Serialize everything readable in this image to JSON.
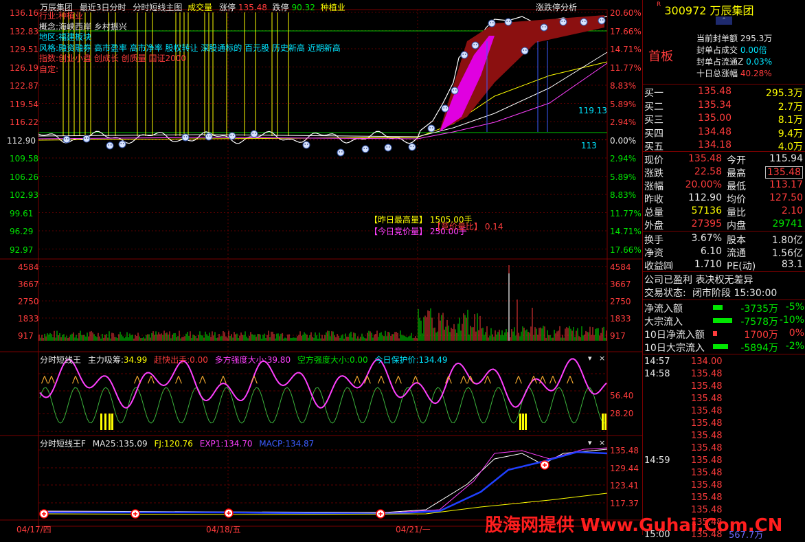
{
  "header": {
    "stock_name": "万辰集团",
    "period": "最近3日分时",
    "indicator": "分时短线主图",
    "volume_label": "成交量",
    "limit_up_label": "涨停",
    "limit_up_value": "135.48",
    "limit_down_label": "跌停",
    "limit_down_value": "90.32",
    "sector": "种植业",
    "analysis_link": "涨跌停分析"
  },
  "info_lines": {
    "industry": "行业:种植业",
    "concept": "概念:海峡西岸 乡村振兴",
    "region": "地区:福建板块",
    "style": "风格:融资融券 高市盈率 高市净率 股权转让 深股通标的 百元股 历史新高 近期新高",
    "index": "指数:创业小盘 创成长 创质量 国证2000",
    "custom": "自定:"
  },
  "price_axis": {
    "left": [
      "136.16",
      "132.83",
      "129.51",
      "126.19",
      "122.87",
      "119.54",
      "116.22",
      "112.90",
      "109.58",
      "106.26",
      "102.93",
      "99.61",
      "96.29",
      "92.97"
    ],
    "right": [
      "20.60%",
      "17.66%",
      "14.71%",
      "11.77%",
      "8.83%",
      "5.89%",
      "2.94%",
      "0.00%",
      "2.94%",
      "5.89%",
      "8.83%",
      "11.77%",
      "14.71%",
      "17.66%"
    ]
  },
  "volume_axis": [
    "4584",
    "3667",
    "2750",
    "1833",
    "917"
  ],
  "price_annotations": {
    "level_1": "113",
    "level_2": "119.13"
  },
  "volume_info": {
    "prev_high_label": "【昨日最高量】",
    "prev_high_value": "1505.00手",
    "today_auction_label": "【今日竞价量】",
    "today_auction_value": "250.00手",
    "auction_ratio_label": "【竞价量比】",
    "auction_ratio_value": "0.14"
  },
  "panel1": {
    "title": "分时短线王",
    "main_label": "主力吸筹:",
    "main_value": "34.99",
    "exit_label": "赶快出手:",
    "exit_value": "0.00",
    "bull_label": "多方强度大小:",
    "bull_value": "39.80",
    "bear_label": "空方强度大小:",
    "bear_value": "0.00",
    "protect_label": "今日保护价:",
    "protect_value": "134.49",
    "axis": [
      "56.40",
      "28.20"
    ]
  },
  "panel2": {
    "title": "分时短线王F",
    "ma25_label": "MA25:",
    "ma25_value": "135.09",
    "fj_label": "FJ:",
    "fj_value": "120.76",
    "exp1_label": "EXP1:",
    "exp1_value": "134.70",
    "macp_label": "MACP:",
    "macp_value": "134.87",
    "axis": [
      "135.48",
      "129.44",
      "123.41",
      "117.37"
    ]
  },
  "date_axis": [
    "04/17/四",
    "04/18/五",
    "04/21/一"
  ],
  "right_panel": {
    "code": "300972",
    "name": "万辰集团",
    "board": "首板",
    "seal_amount_label": "当前封单额",
    "seal_amount": "295.3万",
    "seal_ratio_label": "封单占成交",
    "seal_ratio": "0.00倍",
    "seal_float_label": "封单占流通Z",
    "seal_float": "0.03%",
    "ten_day_label": "十日总涨幅",
    "ten_day": "40.28%",
    "bids": [
      {
        "label": "买一",
        "price": "135.48",
        "vol": "295.3万"
      },
      {
        "label": "买二",
        "price": "135.34",
        "vol": "2.7万"
      },
      {
        "label": "买三",
        "price": "135.00",
        "vol": "8.1万"
      },
      {
        "label": "买四",
        "price": "134.48",
        "vol": "9.4万"
      },
      {
        "label": "买五",
        "price": "134.18",
        "vol": "4.0万"
      }
    ],
    "quote": [
      {
        "l1": "现价",
        "v1": "135.48",
        "l2": "今开",
        "v2": "115.94"
      },
      {
        "l1": "涨跌",
        "v1": "22.58",
        "l2": "最高",
        "v2": "135.48"
      },
      {
        "l1": "涨幅",
        "v1": "20.00%",
        "l2": "最低",
        "v2": "113.17"
      },
      {
        "l1": "昨收",
        "v1": "112.90",
        "l2": "均价",
        "v2": "127.50"
      },
      {
        "l1": "总量",
        "v1": "57136",
        "l2": "量比",
        "v2": "2.10"
      },
      {
        "l1": "外盘",
        "v1": "27395",
        "l2": "内盘",
        "v2": "29741"
      }
    ],
    "fundamentals": [
      {
        "l1": "换手",
        "v1": "3.67%",
        "l2": "股本",
        "v2": "1.80亿"
      },
      {
        "l1": "净资",
        "v1": "6.10",
        "l2": "流通",
        "v2": "1.56亿"
      },
      {
        "l1": "收益㈣",
        "v1": "1.710",
        "l2": "PE(动)",
        "v2": "83.1"
      }
    ],
    "company_status": "公司已盈利 表决权无差异",
    "trade_status_label": "交易状态:",
    "trade_status": "闭市阶段 15:30:00",
    "flows": [
      {
        "label": "净流入额",
        "value": "-3735万",
        "pct": "-5%"
      },
      {
        "label": "大宗流入",
        "value": "-7578万",
        "pct": "-10%"
      },
      {
        "label": "10日净流入额",
        "value": "1700万",
        "pct": "0%"
      },
      {
        "label": "10日大宗流入",
        "value": "-5894万",
        "pct": "-2%"
      }
    ],
    "ticks": [
      {
        "time": "14:57",
        "price": "134.00"
      },
      {
        "time": "14:58",
        "price": "135.48"
      },
      {
        "time": "",
        "price": "135.48"
      },
      {
        "time": "",
        "price": "135.48"
      },
      {
        "time": "",
        "price": "135.48"
      },
      {
        "time": "",
        "price": "135.48"
      },
      {
        "time": "",
        "price": "135.48"
      },
      {
        "time": "",
        "price": "135.48"
      },
      {
        "time": "14:59",
        "price": "135.48"
      },
      {
        "time": "",
        "price": "135.48"
      },
      {
        "time": "",
        "price": "135.48"
      },
      {
        "time": "",
        "price": "135.48"
      },
      {
        "time": "",
        "price": "135.48"
      },
      {
        "time": "",
        "price": "135.48"
      },
      {
        "time": "15:00",
        "price": "135.48"
      }
    ],
    "last_vol": "567.7万"
  },
  "watermark": "股海网提供 Www.Guhai.Com.CN",
  "colors": {
    "up": "#ff3c3c",
    "down": "#00e600",
    "grid": "#7a0000",
    "yellow": "#ffff00",
    "magenta": "#ff40ff",
    "cyan": "#00e5ff"
  }
}
